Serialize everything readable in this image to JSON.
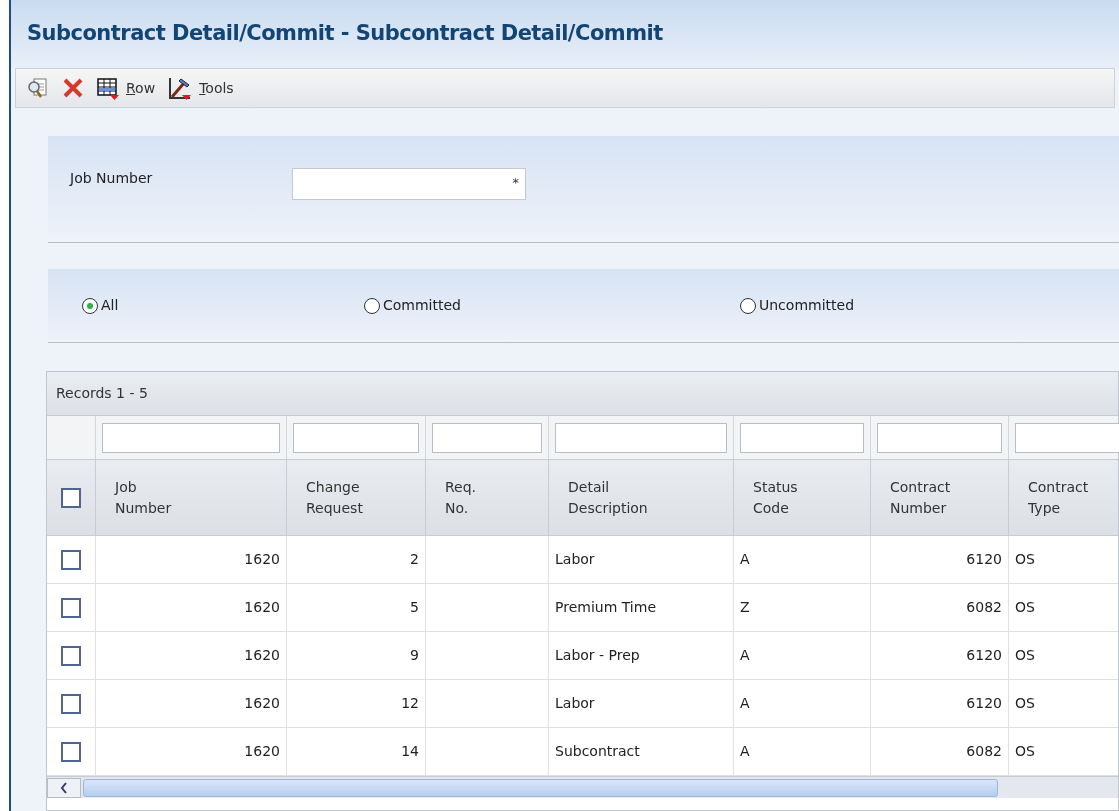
{
  "window": {
    "title": "Subcontract Detail/Commit - Subcontract Detail/Commit"
  },
  "toolbar": [
    {
      "kind": "find"
    },
    {
      "kind": "close"
    },
    {
      "kind": "row",
      "label": "Row"
    },
    {
      "kind": "tools",
      "label": "Tools"
    }
  ],
  "form": {
    "job_number": {
      "label": "Job Number",
      "required_mark": "*"
    }
  },
  "filter_options": [
    {
      "label": "All",
      "selected": true
    },
    {
      "label": "Committed",
      "selected": false
    },
    {
      "label": "Uncommitted",
      "selected": false
    }
  ],
  "grid": {
    "records": "Records 1 - 5",
    "select_all_checked": false,
    "columns": [
      {
        "label": "Job Number",
        "kind": "number"
      },
      {
        "label": "Change Request",
        "kind": "number"
      },
      {
        "label": "Req. No.",
        "kind": "text"
      },
      {
        "label": "Detail Description",
        "kind": "text"
      },
      {
        "label": "Status Code",
        "kind": "text"
      },
      {
        "label": "Contract Number",
        "kind": "number"
      },
      {
        "label": "Contract Type",
        "kind": "text"
      }
    ],
    "rows": [
      {
        "checked": false,
        "cells": [
          "1620",
          "2",
          "",
          "Labor",
          "A",
          "6120",
          "OS"
        ]
      },
      {
        "checked": false,
        "cells": [
          "1620",
          "5",
          "",
          "Premium Time",
          "Z",
          "6082",
          "OS"
        ]
      },
      {
        "checked": false,
        "cells": [
          "1620",
          "9",
          "",
          "Labor - Prep",
          "A",
          "6120",
          "OS"
        ]
      },
      {
        "checked": false,
        "cells": [
          "1620",
          "12",
          "",
          "Labor",
          "A",
          "6120",
          "OS"
        ]
      },
      {
        "checked": false,
        "cells": [
          "1620",
          "14",
          "",
          "Subcontract",
          "A",
          "6082",
          "OS"
        ]
      }
    ]
  }
}
